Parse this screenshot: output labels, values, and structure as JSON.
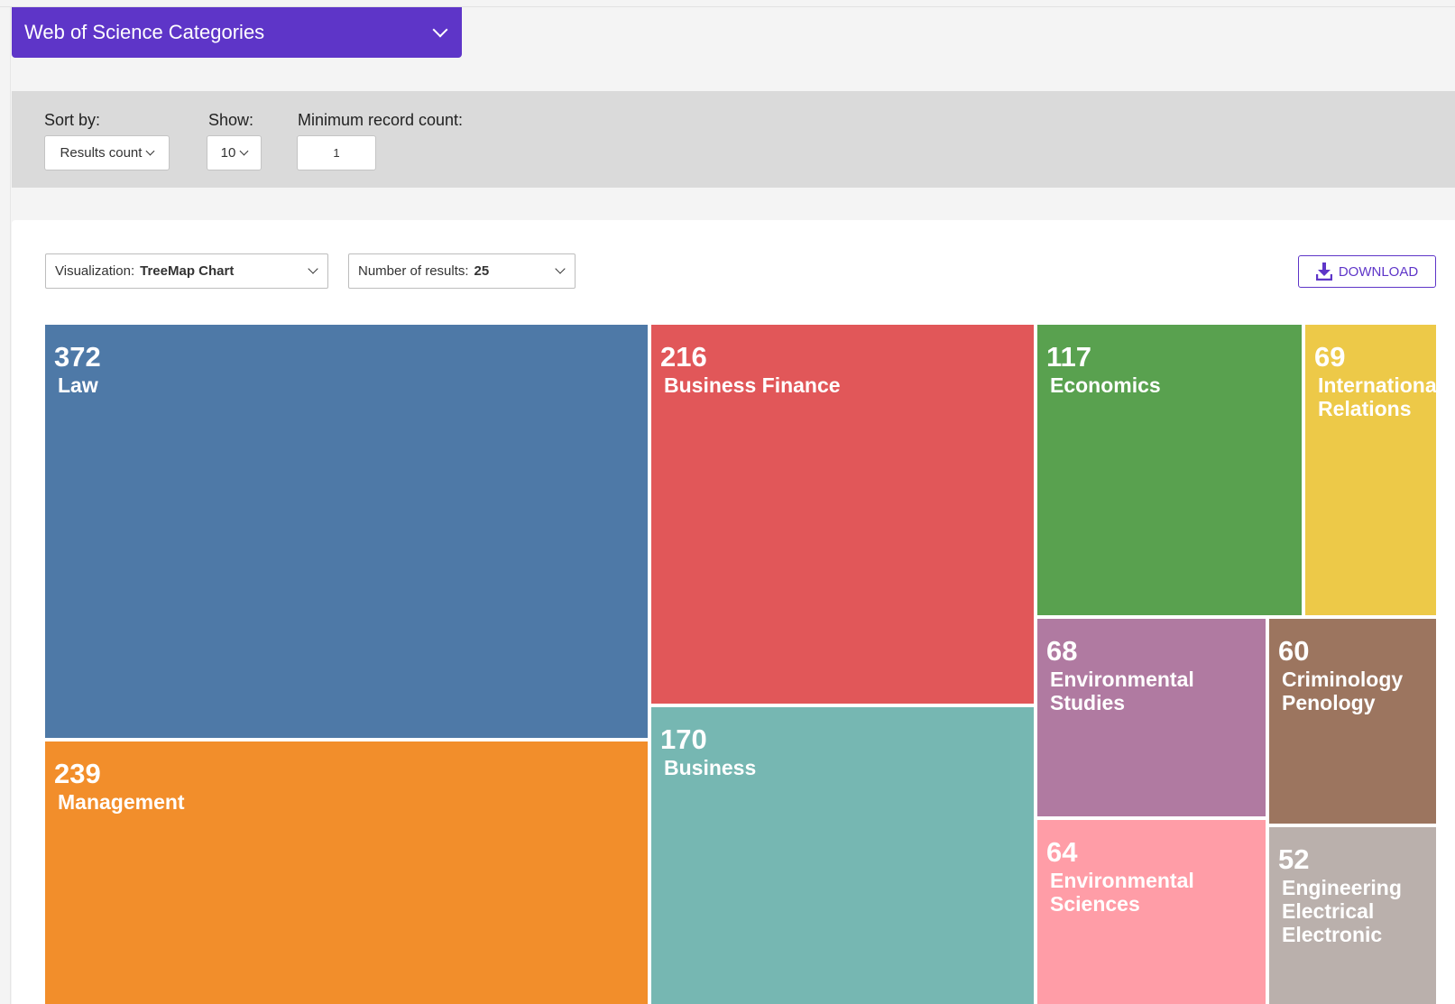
{
  "header": {
    "title": "Web of Science Categories",
    "icon": "chevron-down-icon"
  },
  "filters": {
    "sort_label": "Sort by:",
    "sort_value": "Results count",
    "show_label": "Show:",
    "show_value": "10",
    "min_label": "Minimum record count:",
    "min_value": "1"
  },
  "controls": {
    "viz_label": "Visualization:",
    "viz_value": "TreeMap Chart",
    "results_label": "Number of results:",
    "results_value": "25",
    "download_label": "DOWNLOAD",
    "accent": "#5e35c8"
  },
  "chart_data": {
    "type": "treemap",
    "items": [
      {
        "label": "Law",
        "value": 372,
        "color": "#4e79a7"
      },
      {
        "label": "Management",
        "value": 239,
        "color": "#f28e2b"
      },
      {
        "label": "Business Finance",
        "value": 216,
        "color": "#e15759"
      },
      {
        "label": "Business",
        "value": 170,
        "color": "#76b7b2"
      },
      {
        "label": "Economics",
        "value": 117,
        "color": "#59a14f"
      },
      {
        "label": "International Relations",
        "value": 69,
        "color": "#edc948"
      },
      {
        "label": "Environmental Studies",
        "value": 68,
        "color": "#b07aa1"
      },
      {
        "label": "Criminology Penology",
        "value": 60,
        "color": "#9c755f"
      },
      {
        "label": "Environmental Sciences",
        "value": 64,
        "color": "#ff9da7"
      },
      {
        "label": "Engineering Electrical Electronic",
        "value": 52,
        "color": "#bab0ac"
      }
    ]
  }
}
